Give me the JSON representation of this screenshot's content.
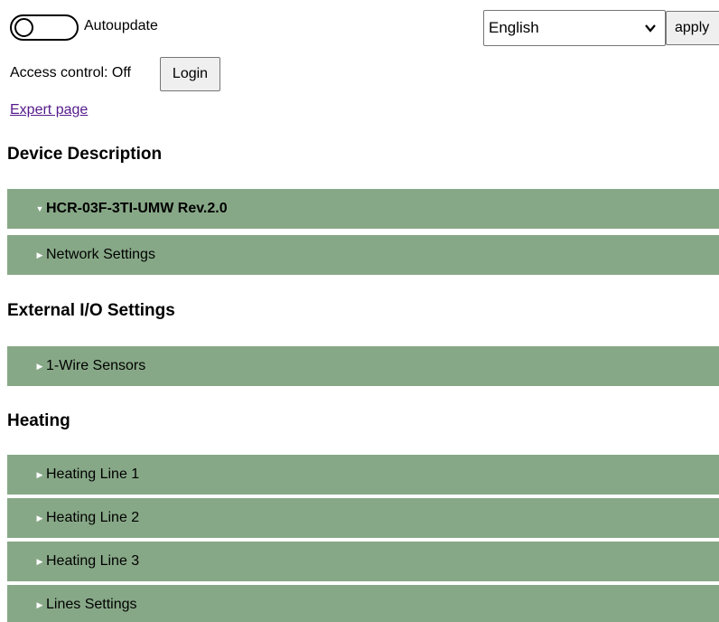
{
  "autoupdate": {
    "label": "Autoupdate",
    "state": "off"
  },
  "language": {
    "selected": "English",
    "apply_label": "apply"
  },
  "access": {
    "text": "Access control: Off",
    "login_label": "Login"
  },
  "expert_link": "Expert page",
  "sections": [
    {
      "title": "Device Description",
      "panels": [
        {
          "label": "HCR-03F-3TI-UMW Rev.2.0",
          "expanded": true
        },
        {
          "label": "Network Settings",
          "expanded": false
        }
      ]
    },
    {
      "title": "External I/O Settings",
      "panels": [
        {
          "label": "1-Wire Sensors",
          "expanded": false
        }
      ]
    },
    {
      "title": "Heating",
      "panels": [
        {
          "label": "Heating Line 1",
          "expanded": false
        },
        {
          "label": "Heating Line 2",
          "expanded": false
        },
        {
          "label": "Heating Line 3",
          "expanded": false
        },
        {
          "label": "Lines Settings",
          "expanded": false
        }
      ]
    }
  ],
  "icons": {
    "collapsed": "triangle-right-icon",
    "expanded": "triangle-down-icon",
    "dropdown": "chevron-down-icon"
  },
  "colors": {
    "panel_bg": "#87a887",
    "link": "#551a8b",
    "arrow": "#ffffff"
  }
}
